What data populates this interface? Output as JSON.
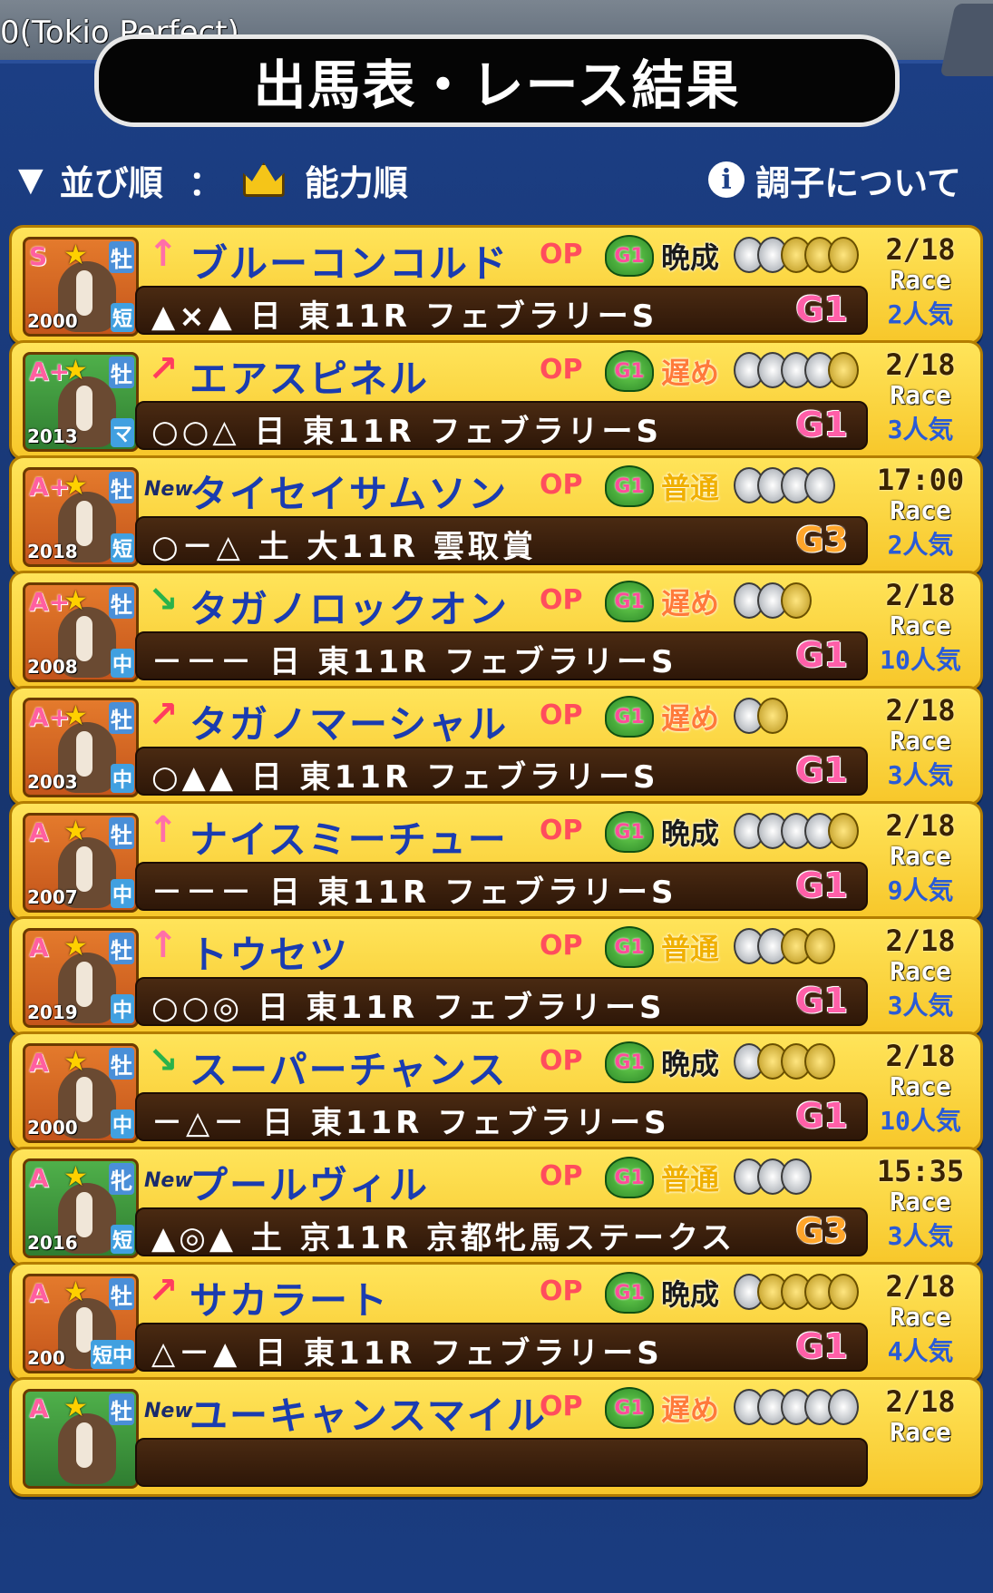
{
  "overlay_label": "0(Tokio Perfect)",
  "title": "出馬表・レース結果",
  "sort": {
    "label": "並び順",
    "colon": "：",
    "value": "能力順"
  },
  "condition_link": "調子について",
  "rows": [
    {
      "rank": "S",
      "sex": "牡",
      "year": "2000",
      "dist": "短",
      "arrow": "↑",
      "arrow_type": "up",
      "new": "",
      "name": "ブルーコンコルド",
      "op": "OP",
      "g1": "G1",
      "style": "晩成",
      "style_type": "early",
      "coins_silver": 2,
      "coins_gold": 3,
      "date": "2/18",
      "race": "Race",
      "pop": "2人気",
      "marks": "▲×▲ 日 東11R フェブラリーS",
      "grade": "G1",
      "portrait": "orange"
    },
    {
      "rank": "A+",
      "sex": "牡",
      "year": "2013",
      "dist": "マ",
      "arrow": "↗",
      "arrow_type": "diag",
      "new": "",
      "name": "エアスピネル",
      "op": "OP",
      "g1": "G1",
      "style": "遅め",
      "style_type": "late",
      "coins_silver": 4,
      "coins_gold": 1,
      "date": "2/18",
      "race": "Race",
      "pop": "3人気",
      "marks": "○○△ 日 東11R フェブラリーS",
      "grade": "G1",
      "portrait": "green"
    },
    {
      "rank": "A+",
      "sex": "牡",
      "year": "2018",
      "dist": "短",
      "arrow": "",
      "arrow_type": "",
      "new": "New",
      "name": "タイセイサムソン",
      "op": "OP",
      "g1": "G1",
      "style": "普通",
      "style_type": "normal",
      "coins_silver": 4,
      "coins_gold": 0,
      "date": "17:00",
      "race": "Race",
      "pop": "2人気",
      "marks": "○－△ 土 大11R 雲取賞",
      "grade": "G3",
      "portrait": "orange"
    },
    {
      "rank": "A+",
      "sex": "牡",
      "year": "2008",
      "dist": "中",
      "arrow": "↘",
      "arrow_type": "down",
      "new": "",
      "name": "タガノロックオン",
      "op": "OP",
      "g1": "G1",
      "style": "遅め",
      "style_type": "late",
      "coins_silver": 2,
      "coins_gold": 1,
      "date": "2/18",
      "race": "Race",
      "pop": "10人気",
      "marks": "－－－ 日 東11R フェブラリーS",
      "grade": "G1",
      "portrait": "orange"
    },
    {
      "rank": "A+",
      "sex": "牡",
      "year": "2003",
      "dist": "中",
      "arrow": "↗",
      "arrow_type": "diag",
      "new": "",
      "name": "タガノマーシャル",
      "op": "OP",
      "g1": "G1",
      "style": "遅め",
      "style_type": "late",
      "coins_silver": 1,
      "coins_gold": 1,
      "date": "2/18",
      "race": "Race",
      "pop": "3人気",
      "marks": "○▲▲ 日 東11R フェブラリーS",
      "grade": "G1",
      "portrait": "orange"
    },
    {
      "rank": "A",
      "sex": "牡",
      "year": "2007",
      "dist": "中",
      "arrow": "↑",
      "arrow_type": "up",
      "new": "",
      "name": "ナイスミーチュー",
      "op": "OP",
      "g1": "G1",
      "style": "晩成",
      "style_type": "early",
      "coins_silver": 4,
      "coins_gold": 1,
      "date": "2/18",
      "race": "Race",
      "pop": "9人気",
      "marks": "－－－ 日 東11R フェブラリーS",
      "grade": "G1",
      "portrait": "orange"
    },
    {
      "rank": "A",
      "sex": "牡",
      "year": "2019",
      "dist": "中",
      "arrow": "↑",
      "arrow_type": "up",
      "new": "",
      "name": "トウセツ",
      "op": "OP",
      "g1": "G1",
      "style": "普通",
      "style_type": "normal",
      "coins_silver": 2,
      "coins_gold": 2,
      "date": "2/18",
      "race": "Race",
      "pop": "3人気",
      "marks": "○○◎ 日 東11R フェブラリーS",
      "grade": "G1",
      "portrait": "orange"
    },
    {
      "rank": "A",
      "sex": "牡",
      "year": "2000",
      "dist": "中",
      "arrow": "↘",
      "arrow_type": "down",
      "new": "",
      "name": "スーパーチャンス",
      "op": "OP",
      "g1": "G1",
      "style": "晩成",
      "style_type": "early",
      "coins_silver": 1,
      "coins_gold": 3,
      "date": "2/18",
      "race": "Race",
      "pop": "10人気",
      "marks": "－△－ 日 東11R フェブラリーS",
      "grade": "G1",
      "portrait": "orange"
    },
    {
      "rank": "A",
      "sex": "牝",
      "year": "2016",
      "dist": "短",
      "arrow": "",
      "arrow_type": "",
      "new": "New",
      "name": "プールヴィル",
      "op": "OP",
      "g1": "G1",
      "style": "普通",
      "style_type": "normal",
      "coins_silver": 3,
      "coins_gold": 0,
      "date": "15:35",
      "race": "Race",
      "pop": "3人気",
      "marks": "▲◎▲ 土 京11R 京都牝馬ステークス",
      "grade": "G3",
      "portrait": "green"
    },
    {
      "rank": "A",
      "sex": "牡",
      "year": "200",
      "dist": "短中",
      "arrow": "↗",
      "arrow_type": "diag",
      "new": "",
      "name": "サカラート",
      "op": "OP",
      "g1": "G1",
      "style": "晩成",
      "style_type": "early",
      "coins_silver": 1,
      "coins_gold": 4,
      "date": "2/18",
      "race": "Race",
      "pop": "4人気",
      "marks": "△－▲ 日 東11R フェブラリーS",
      "grade": "G1",
      "portrait": "orange"
    },
    {
      "rank": "A",
      "sex": "牡",
      "year": "",
      "dist": "",
      "arrow": "",
      "arrow_type": "",
      "new": "New",
      "name": "ユーキャンスマイル",
      "op": "OP",
      "g1": "G1",
      "style": "遅め",
      "style_type": "late",
      "coins_silver": 5,
      "coins_gold": 0,
      "date": "2/18",
      "race": "Race",
      "pop": "",
      "marks": "",
      "grade": "",
      "portrait": "green"
    }
  ]
}
